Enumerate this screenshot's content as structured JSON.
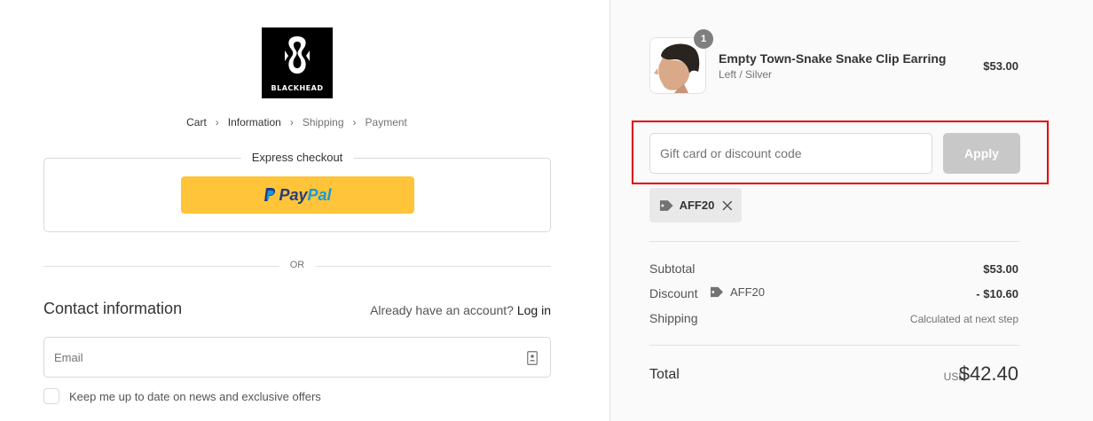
{
  "brand": {
    "logo_text": "BLACKHEAD"
  },
  "breadcrumb": [
    {
      "label": "Cart"
    },
    {
      "label": "Information"
    },
    {
      "label": "Shipping"
    },
    {
      "label": "Payment"
    }
  ],
  "express_checkout": {
    "title": "Express checkout",
    "paypal_pay": "Pay",
    "paypal_pal": "Pal"
  },
  "divider_or": "OR",
  "contact": {
    "title": "Contact information",
    "account_prompt": "Already have an account?",
    "login_label": "Log in",
    "email_placeholder": "Email",
    "email_value": "",
    "newsletter_label": "Keep me up to date on news and exclusive offers"
  },
  "cart": {
    "items": [
      {
        "name": "Empty Town-Snake Snake Clip Earring",
        "variant": "Left / Silver",
        "price": "$53.00",
        "quantity": "1"
      }
    ]
  },
  "discount": {
    "placeholder": "Gift card or discount code",
    "apply_label": "Apply",
    "applied_code": "AFF20"
  },
  "summary": {
    "subtotal_label": "Subtotal",
    "subtotal_value": "$53.00",
    "discount_label": "Discount",
    "discount_code": "AFF20",
    "discount_value": "- $10.60",
    "shipping_label": "Shipping",
    "shipping_value": "Calculated at next step",
    "total_label": "Total",
    "total_currency": "USD",
    "total_value": "$42.40"
  },
  "colors": {
    "paypal_yellow": "#ffc439",
    "paypal_dark_blue": "#253b80",
    "paypal_light_blue": "#179bd7",
    "highlight_red": "#e00000",
    "apply_disabled": "#c8c8c8",
    "sidebar_bg": "#fafafa"
  }
}
